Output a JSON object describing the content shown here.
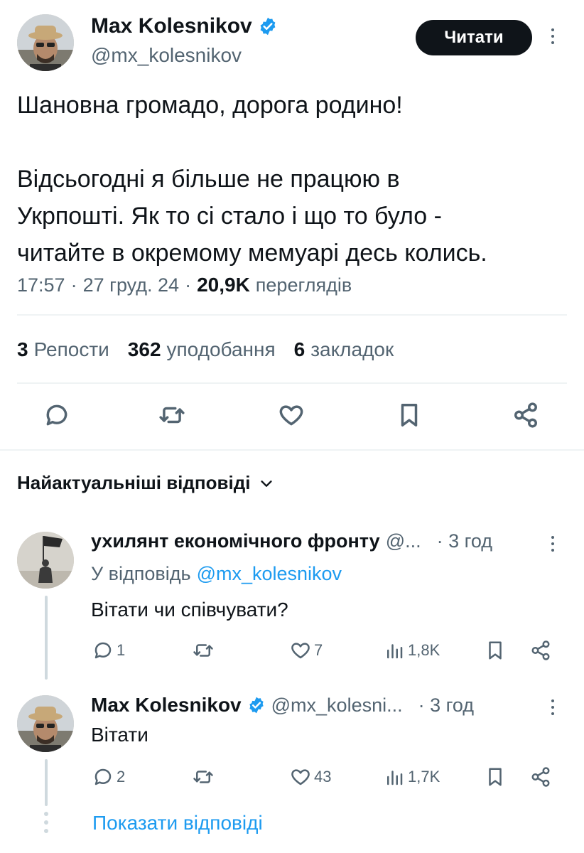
{
  "main_tweet": {
    "author_name": "Max Kolesnikov",
    "handle": "@mx_kolesnikov",
    "follow_label": "Читати",
    "text_line1": "Шановна громадо, дорога родино!",
    "text_line2": "Відсьогодні я більше не працюю в",
    "text_line3": "Укрпошті. Як то сі стало і що то було -",
    "text_line4": "читайте в окремому мемуарі десь колись.",
    "time": "17:57",
    "date": "27 груд. 24",
    "views_count": "20,9K",
    "views_label": "переглядів",
    "sep": "·",
    "reposts_count": "3",
    "reposts_label": "Репости",
    "likes_count": "362",
    "likes_label": "уподобання",
    "bookmarks_count": "6",
    "bookmarks_label": "закладок"
  },
  "replies_header": {
    "label": "Найактуальніші відповіді"
  },
  "replies": [
    {
      "author_name": "ухилянт економічного фронту",
      "handle": "@...",
      "time": "· 3 год",
      "replying_prefix": "У відповідь",
      "replying_to": "@mx_kolesnikov",
      "text": "Вітати чи співчувати?",
      "reply_count": "1",
      "like_count": "7",
      "view_count": "1,8K"
    },
    {
      "author_name": "Max Kolesnikov",
      "handle": "@mx_kolesni...",
      "time": "· 3 год",
      "text": "Вітати",
      "reply_count": "2",
      "like_count": "43",
      "view_count": "1,7K"
    }
  ],
  "show_replies": "Показати відповіді",
  "colors": {
    "text": "#0f1419",
    "muted": "#536471",
    "link": "#1d9bf0",
    "verified": "#1d9bf0",
    "divider": "#eff3f4"
  },
  "icons": [
    "verified-badge-icon",
    "more-icon",
    "reply-icon",
    "repost-icon",
    "like-icon",
    "bookmark-icon",
    "share-icon",
    "views-icon",
    "chevron-down-icon"
  ]
}
